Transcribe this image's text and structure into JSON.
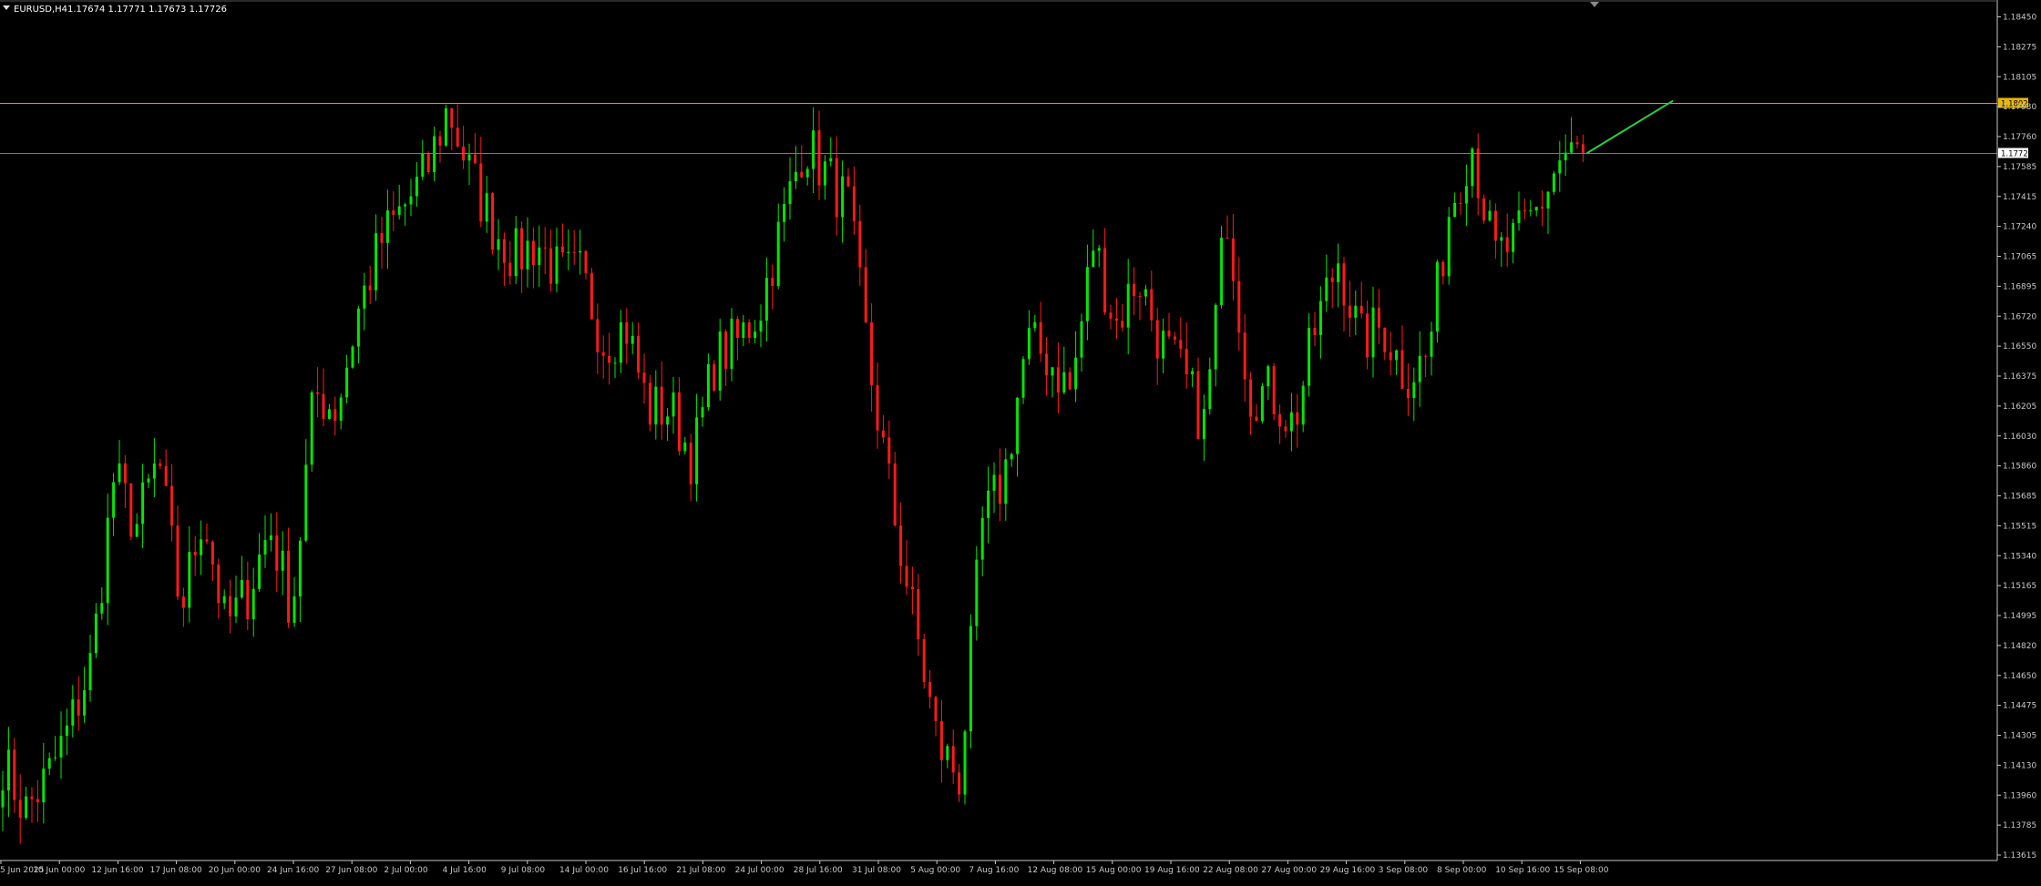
{
  "header": {
    "symbol": "EURUSD,H4",
    "ohlc": "1.17674 1.17771 1.17673 1.17726"
  },
  "colors": {
    "background": "#000000",
    "bull": "#00e600",
    "bear": "#ff1a1a",
    "axis": "#c8c8c8",
    "resistance_line": "#d4a017",
    "current_line": "#7a7a7a",
    "projection": "#2ecc40"
  },
  "chart_data": {
    "type": "candlestick",
    "timeframe": "H4",
    "ylim": [
      1.1354,
      1.1854
    ],
    "ytick_labels": [
      "1.18450",
      "1.18275",
      "1.18105",
      "1.17930",
      "1.17760",
      "1.17585",
      "1.17415",
      "1.17240",
      "1.17065",
      "1.16895",
      "1.16720",
      "1.16550",
      "1.16375",
      "1.16205",
      "1.16030",
      "1.15860",
      "1.15685",
      "1.15515",
      "1.15340",
      "1.15165",
      "1.14995",
      "1.14820",
      "1.14650",
      "1.14475",
      "1.14305",
      "1.14130",
      "1.13960",
      "1.13785",
      "1.13615"
    ],
    "xtick_labels": [
      "5 Jun 2025",
      "10 Jun 00:00",
      "12 Jun 16:00",
      "17 Jun 08:00",
      "20 Jun 00:00",
      "24 Jun 16:00",
      "27 Jun 08:00",
      "2 Jul 00:00",
      "4 Jul 16:00",
      "9 Jul 08:00",
      "14 Jul 00:00",
      "16 Jul 16:00",
      "21 Jul 08:00",
      "24 Jul 00:00",
      "28 Jul 16:00",
      "31 Jul 08:00",
      "5 Aug 00:00",
      "7 Aug 16:00",
      "12 Aug 08:00",
      "15 Aug 00:00",
      "19 Aug 16:00",
      "22 Aug 08:00",
      "27 Aug 00:00",
      "29 Aug 16:00",
      "3 Sep 08:00",
      "8 Sep 00:00",
      "10 Sep 16:00",
      "15 Sep 08:00"
    ],
    "close_path": [
      1.141,
      1.138,
      1.14,
      1.143,
      1.147,
      1.158,
      1.155,
      1.159,
      1.15,
      1.156,
      1.149,
      1.151,
      1.155,
      1.15,
      1.163,
      1.162,
      1.168,
      1.172,
      1.174,
      1.176,
      1.18,
      1.176,
      1.173,
      1.171,
      1.172,
      1.17,
      1.17,
      1.166,
      1.167,
      1.162,
      1.162,
      1.159,
      1.165,
      1.166,
      1.168,
      1.173,
      1.178,
      1.176,
      1.174,
      1.164,
      1.156,
      1.149,
      1.142,
      1.14,
      1.155,
      1.158,
      1.166,
      1.165,
      1.163,
      1.172,
      1.167,
      1.17,
      1.166,
      1.164,
      1.161,
      1.174,
      1.163,
      1.163,
      1.161,
      1.167,
      1.171,
      1.166,
      1.167,
      1.164,
      1.165,
      1.174,
      1.178,
      1.171,
      1.172,
      1.174,
      1.177,
      1.1773
    ],
    "bars": 272,
    "hlines": [
      {
        "name": "resistance",
        "price": 1.18028,
        "label": "1.18028"
      },
      {
        "name": "current-price",
        "price": 1.17726,
        "label": "1.17726"
      }
    ],
    "projection": {
      "from": [
        271,
        1.17726
      ],
      "to": [
        283,
        1.1804
      ]
    },
    "grid": false,
    "legend": "none"
  }
}
